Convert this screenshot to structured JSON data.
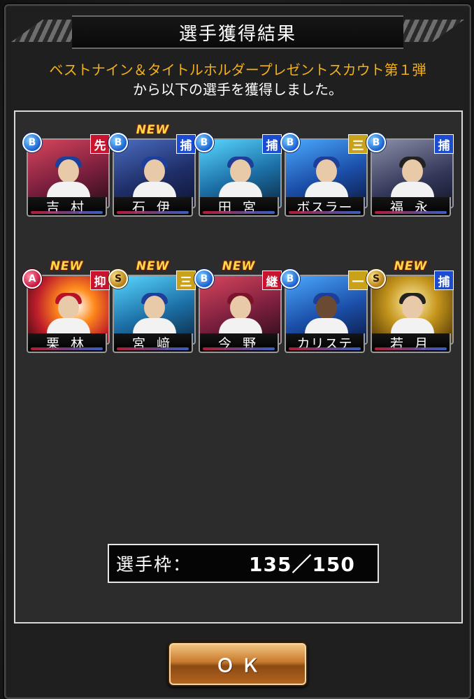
{
  "dialog": {
    "title": "選手獲得結果",
    "message_line1": "ベストナイン＆タイトルホルダープレゼントスカウト第１弾",
    "message_line2": "から以下の選手を獲得しました。"
  },
  "players": [
    {
      "name": "吉 村",
      "rank": "B",
      "position": "先",
      "is_new": false,
      "new_label": ""
    },
    {
      "name": "石 伊",
      "rank": "B",
      "position": "捕",
      "is_new": true,
      "new_label": "NEW"
    },
    {
      "name": "田 宮",
      "rank": "B",
      "position": "捕",
      "is_new": false,
      "new_label": ""
    },
    {
      "name": "ボスラー",
      "rank": "B",
      "position": "三",
      "is_new": false,
      "new_label": ""
    },
    {
      "name": "福 永",
      "rank": "B",
      "position": "捕",
      "is_new": false,
      "new_label": ""
    },
    {
      "name": "栗 林",
      "rank": "A",
      "position": "抑",
      "is_new": true,
      "new_label": "NEW"
    },
    {
      "name": "宮 﨑",
      "rank": "S",
      "position": "三",
      "is_new": true,
      "new_label": "NEW"
    },
    {
      "name": "今 野",
      "rank": "B",
      "position": "継",
      "is_new": true,
      "new_label": "NEW"
    },
    {
      "name": "カリステ",
      "rank": "B",
      "position": "一",
      "is_new": false,
      "new_label": ""
    },
    {
      "name": "若 月",
      "rank": "S",
      "position": "捕",
      "is_new": true,
      "new_label": "NEW"
    }
  ],
  "roster": {
    "label": "選手枠：",
    "value": "135／150"
  },
  "ok_button": {
    "label": "ＯＫ"
  },
  "colors": {
    "message_highlight": "#f2b01e",
    "position_pitcher": "#c8142e",
    "position_catcher": "#1b4bd0",
    "position_infield": "#c9a21a",
    "new_label": "#ffd84a"
  }
}
